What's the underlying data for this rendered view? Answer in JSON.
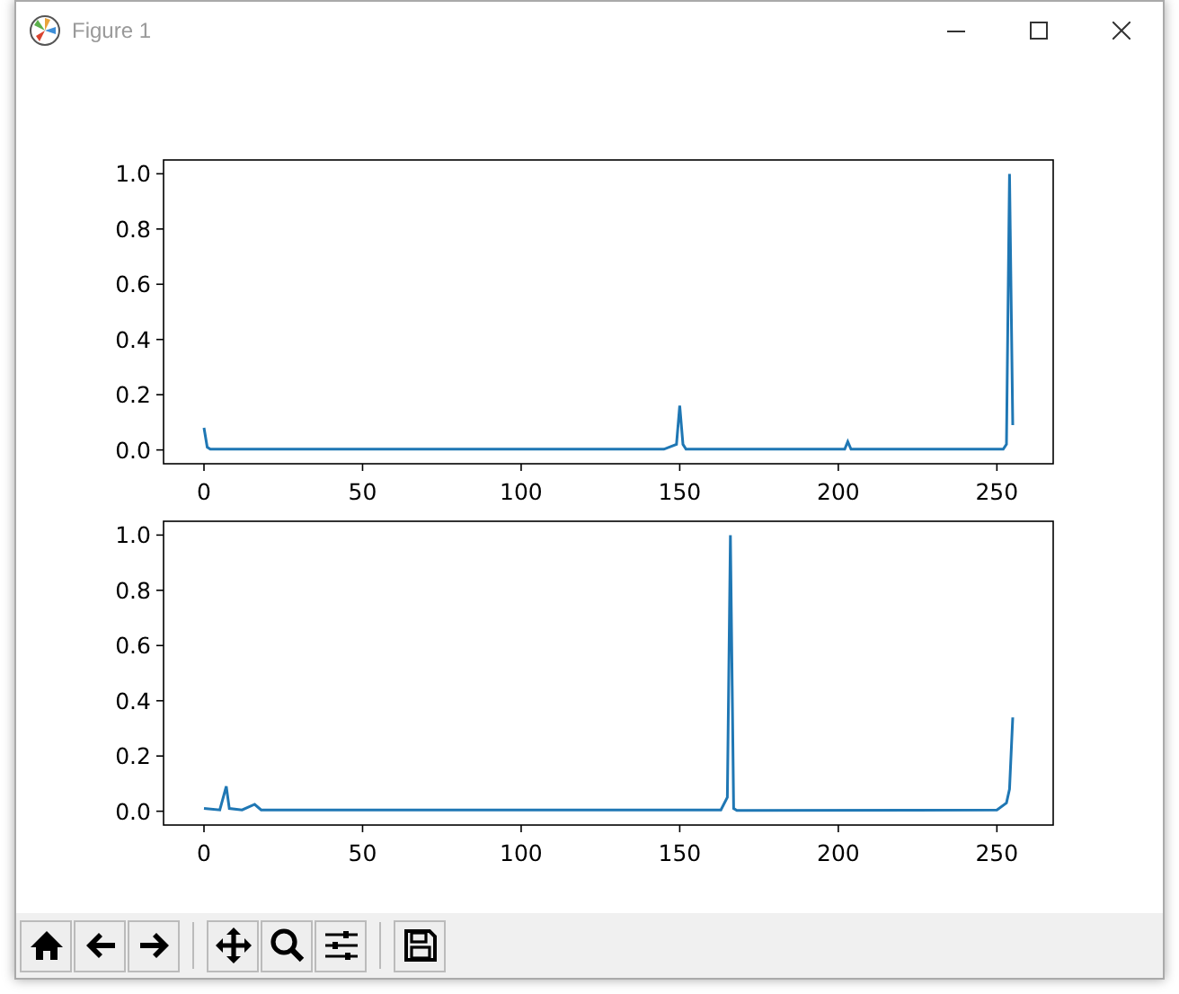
{
  "window": {
    "title": "Figure 1"
  },
  "figure": {
    "charts": [
      {
        "chart_data": {
          "type": "line",
          "x": [
            0,
            1,
            2,
            145,
            149,
            150,
            151,
            152,
            202,
            203,
            204,
            252,
            253,
            254,
            255
          ],
          "series": [
            {
              "color": "#1f77b4",
              "values": [
                0.08,
                0.01,
                0.003,
                0.003,
                0.02,
                0.16,
                0.02,
                0.003,
                0.003,
                0.03,
                0.003,
                0.003,
                0.02,
                1.0,
                0.09
              ]
            }
          ],
          "xlim": [
            -12.75,
            267.75
          ],
          "ylim": [
            -0.05,
            1.05
          ],
          "xticks": [
            0,
            50,
            100,
            150,
            200,
            250
          ],
          "yticks": [
            {
              "value": 0,
              "label": "0.0"
            },
            {
              "value": 0.2,
              "label": "0.2"
            },
            {
              "value": 0.4,
              "label": "0.4"
            },
            {
              "value": 0.6,
              "label": "0.6"
            },
            {
              "value": 0.8,
              "label": "0.8"
            },
            {
              "value": 1,
              "label": "1.0"
            }
          ]
        }
      },
      {
        "chart_data": {
          "type": "line",
          "x": [
            0,
            5,
            7,
            8,
            12,
            16,
            18,
            163,
            165,
            166,
            167,
            168,
            250,
            253,
            254,
            255
          ],
          "series": [
            {
              "color": "#1f77b4",
              "values": [
                0.01,
                0.005,
                0.09,
                0.01,
                0.005,
                0.025,
                0.005,
                0.005,
                0.05,
                1.0,
                0.01,
                0.003,
                0.005,
                0.03,
                0.08,
                0.34
              ]
            }
          ],
          "xlim": [
            -12.75,
            267.75
          ],
          "ylim": [
            -0.05,
            1.05
          ],
          "xticks": [
            0,
            50,
            100,
            150,
            200,
            250
          ],
          "yticks": [
            {
              "value": 0,
              "label": "0.0"
            },
            {
              "value": 0.2,
              "label": "0.2"
            },
            {
              "value": 0.4,
              "label": "0.4"
            },
            {
              "value": 0.6,
              "label": "0.6"
            },
            {
              "value": 0.8,
              "label": "0.8"
            },
            {
              "value": 1,
              "label": "1.0"
            }
          ]
        }
      }
    ]
  },
  "toolbar": {
    "groups": [
      {
        "buttons": [
          {
            "kind": "home"
          },
          {
            "kind": "back"
          },
          {
            "kind": "forward"
          }
        ]
      },
      {
        "buttons": [
          {
            "kind": "pan"
          },
          {
            "kind": "zoom"
          },
          {
            "kind": "configure"
          }
        ]
      },
      {
        "buttons": [
          {
            "kind": "save"
          }
        ]
      }
    ]
  }
}
